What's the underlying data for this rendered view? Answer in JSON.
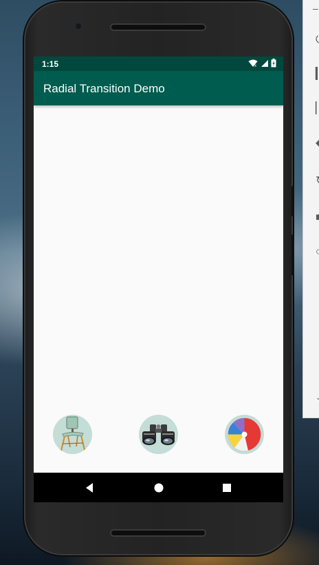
{
  "status_bar": {
    "time": "1:15",
    "icons": [
      "wifi-icon",
      "signal-icon",
      "battery-icon"
    ]
  },
  "app_bar": {
    "title": "Radial Transition Demo",
    "color": "#005c4f",
    "status_color": "#00483d"
  },
  "thumbnails": [
    {
      "name": "chair",
      "icon": "chair-image"
    },
    {
      "name": "binoculars",
      "icon": "binoculars-image"
    },
    {
      "name": "beach ball",
      "icon": "beach-ball-image"
    }
  ],
  "navigation": {
    "buttons": [
      "back",
      "home",
      "recents"
    ]
  },
  "emulator_toolbar": {
    "icons": [
      "minimize-icon",
      "power-icon",
      "volume-up-icon",
      "volume-down-icon",
      "rotate-left-icon",
      "rotate-right-icon",
      "screenshot-icon",
      "zoom-icon"
    ]
  }
}
